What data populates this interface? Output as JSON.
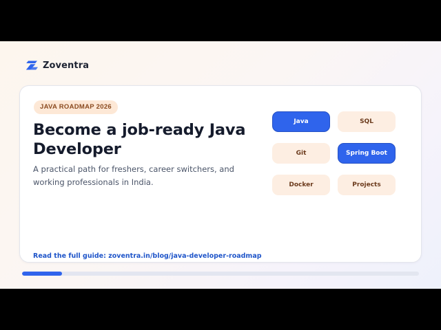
{
  "brand": {
    "name": "Zoventra",
    "logo_icon": "zoventra-logo-icon",
    "logo_color": "#2f64ec"
  },
  "card": {
    "tag": "JAVA ROADMAP 2026",
    "title": "Become a job-ready Java Developer",
    "subtitle": "A practical path for freshers, career switchers, and working professionals in India.",
    "guide_link": "Read the full guide: zoventra.in/blog/java-developer-roadmap"
  },
  "skills": [
    {
      "label": "Java",
      "active": true
    },
    {
      "label": "SQL",
      "active": false
    },
    {
      "label": "Git",
      "active": false
    },
    {
      "label": "Spring Boot",
      "active": true
    },
    {
      "label": "Docker",
      "active": false
    },
    {
      "label": "Projects",
      "active": false
    }
  ],
  "colors": {
    "accent": "#2f64ec",
    "tag_bg": "#fde8d6",
    "pill_inactive_bg": "#fdeee2",
    "link": "#1f55c9"
  },
  "progress": {
    "fraction": 0.1
  }
}
